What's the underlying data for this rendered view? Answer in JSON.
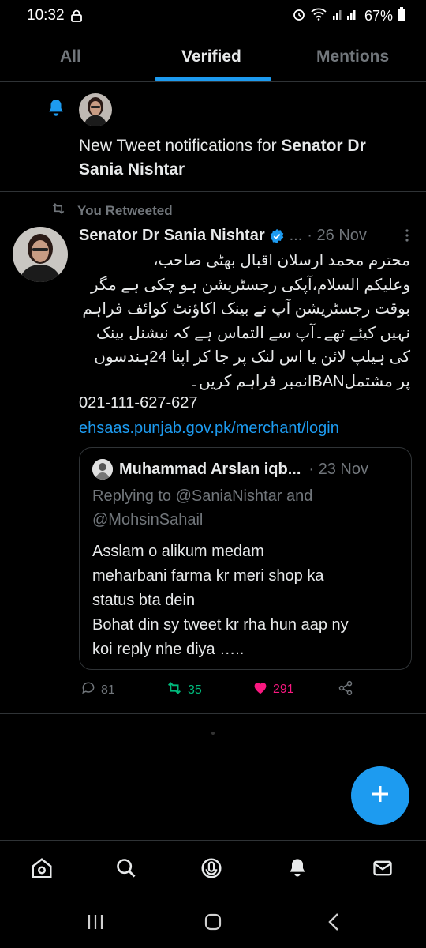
{
  "status_bar": {
    "time": "10:32",
    "battery": "67%"
  },
  "tabs": [
    {
      "label": "All"
    },
    {
      "label": "Verified"
    },
    {
      "label": "Mentions"
    }
  ],
  "notification": {
    "text_prefix": "New Tweet notifications for ",
    "account": "Senator Dr Sania Nishtar"
  },
  "tweet": {
    "retweet_label": "You Retweeted",
    "author": "Senator Dr Sania Nishtar",
    "ellipsis": "...",
    "date": "· 26 Nov",
    "urdu_lines": [
      "محترم محمد ارسلان اقبال بھٹی صاحب،",
      "وعلیکم السلام،آپکی رجسٹریشن ہو چکی ہے مگر",
      "بوقت رجسٹریشن آپ نے بینک اکاؤنٹ کوائف فراہم",
      "نہیں کیئے تھے۔آپ سے التماس ہے کہ نیشنل بینک",
      "کی ہیلپ لائن یا اس لنک پر جا کر اپنا 24ہندسوں",
      "پر مشتملIBANنمبر فراہم کریں۔"
    ],
    "phone": "021-111-627-627",
    "link": "ehsaas.punjab.gov.pk/merchant/login",
    "quote": {
      "author": "Muhammad Arslan iqb...",
      "date": "· 23 Nov",
      "replying_line1": "Replying to @SaniaNishtar and",
      "replying_line2": "@MohsinSahail",
      "body": "Asslam o alikum medam\n meharbani farma kr meri shop ka\nstatus bta dein\nBohat din sy tweet kr rha hun aap ny\nkoi reply nhe diya ….."
    },
    "replies": "81",
    "retweets": "35",
    "likes": "291"
  },
  "colors": {
    "accent": "#1d9bf0",
    "retweet": "#00ba7c",
    "like": "#f91880",
    "muted": "#71767b"
  }
}
